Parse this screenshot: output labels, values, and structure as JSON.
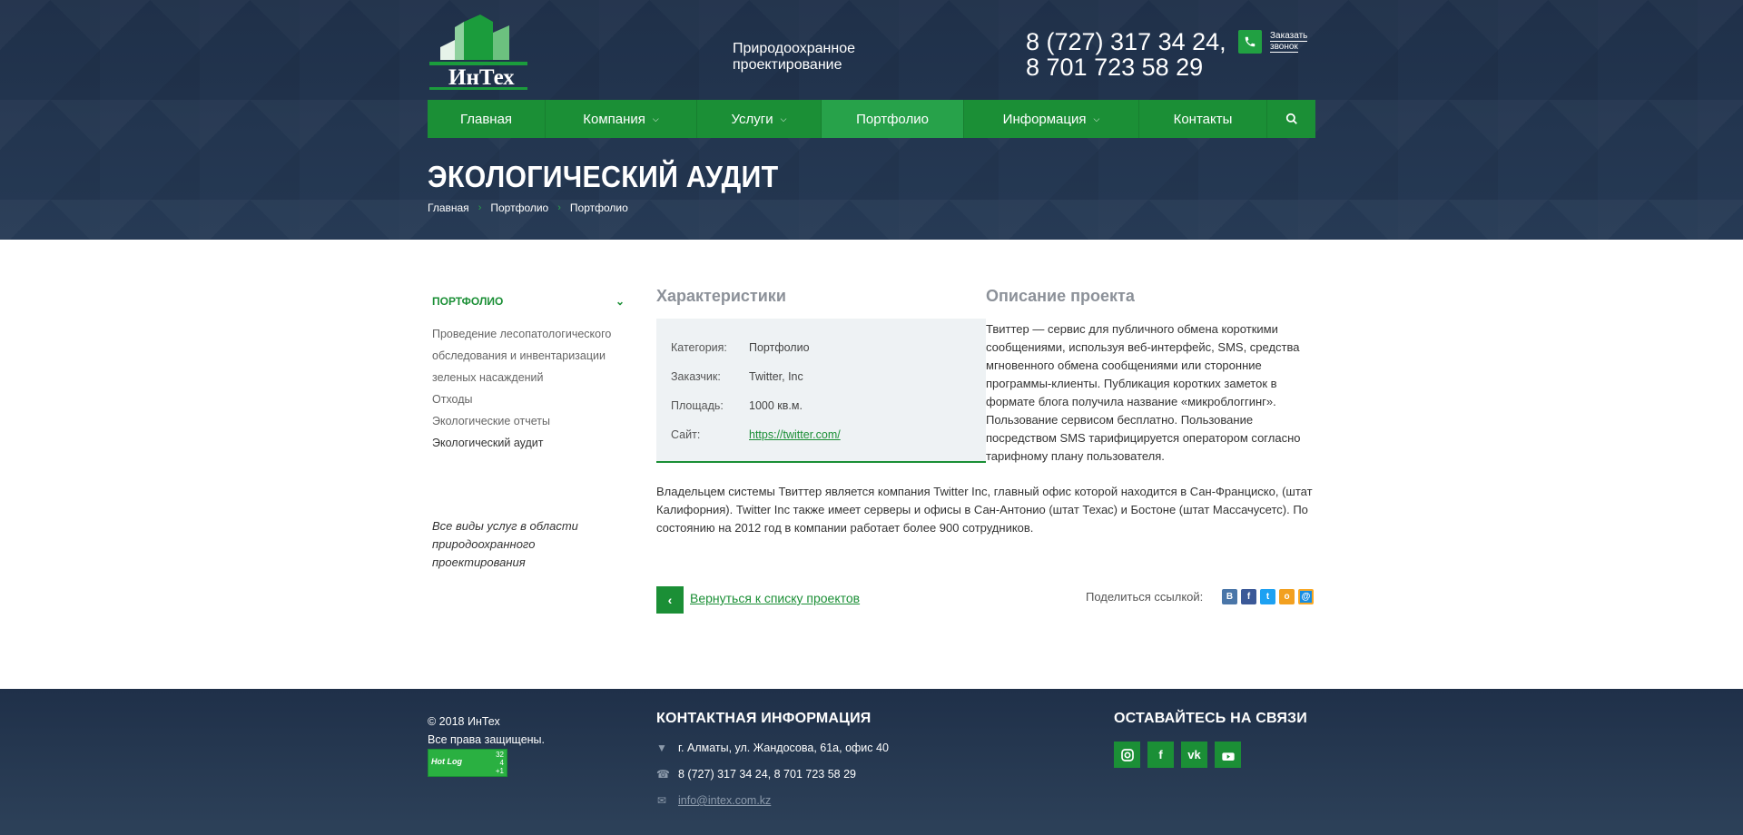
{
  "header": {
    "logo_text": "ИнТех",
    "tagline_line1": "Природоохранное",
    "tagline_line2": "проектирование",
    "phone1": "8 (727) 317 34 24,",
    "phone2": "8 701 723 58 29",
    "callback_line1": "Заказать",
    "callback_line2": "звонок",
    "nav": [
      {
        "label": "Главная",
        "dropdown": false
      },
      {
        "label": "Компания",
        "dropdown": true
      },
      {
        "label": "Услуги",
        "dropdown": true
      },
      {
        "label": "Портфолио",
        "dropdown": false,
        "active": true
      },
      {
        "label": "Информация",
        "dropdown": true
      },
      {
        "label": "Контакты",
        "dropdown": false
      }
    ],
    "page_title": "ЭКОЛОГИЧЕСКИЙ АУДИТ",
    "breadcrumb": [
      "Главная",
      "Портфолио",
      "Портфолио"
    ]
  },
  "sidebar": {
    "heading": "ПОРТФОЛИО",
    "items": [
      "Проведение лесопатологического обследования и инвентаризации зеленых насаждений",
      "Отходы",
      "Экологические отчеты",
      "Экологический аудит"
    ],
    "note": "Все виды услуг в области природоохранного проектирования"
  },
  "main": {
    "characteristics_heading": "Характеристики",
    "description_heading": "Описание проекта",
    "props": [
      {
        "label": "Категория:",
        "value": "Портфолио"
      },
      {
        "label": "Заказчик:",
        "value": "Twitter, Inc"
      },
      {
        "label": "Площадь:",
        "value": "1000 кв.м."
      },
      {
        "label": "Сайт:",
        "value": "https://twitter.com/"
      }
    ],
    "description_p1": "Твиттер — сервис для публичного обмена короткими сообщениями, используя веб-интерфейс, SMS, средства мгновенного обмена сообщениями или сторонние программы-клиенты. Публикация коротких заметок в формате блога получила название «микроблоггинг». Пользование сервисом бесплатно. Пользование посредством SMS тарифицируется оператором согласно тарифному плану пользователя.",
    "description_p2": "Владельцем системы Твиттер является компания Twitter Inc, главный офис которой находится в Сан-Франциско, (штат Калифорния). Twitter Inc также имеет серверы и офисы в Сан-Антонио (штат Техас) и Бостоне (штат Массачусетс). По состоянию на 2012 год в компании работает более 900 сотрудников.",
    "back_link": "Вернуться к списку проектов",
    "share_label": "Поделиться ссылкой:"
  },
  "footer": {
    "copyright": "© 2018 ИнТех",
    "rights": "Все права защищены.",
    "counter_label": "Hot Log",
    "counter_nums": [
      "32",
      "4",
      "+1"
    ],
    "contact_heading": "КОНТАКТНАЯ ИНФОРМАЦИЯ",
    "address": "г. Алматы, ул. Жандосова, 61а, офис 40",
    "phones": "8 (727) 317 34 24, 8 701 723 58 29",
    "email": "info@intex.com.kz",
    "social_heading": "ОСТАВАЙТЕСЬ НА СВЯЗИ"
  },
  "colors": {
    "brand_green": "#1b8f36",
    "header_bg": "#1f3049"
  }
}
